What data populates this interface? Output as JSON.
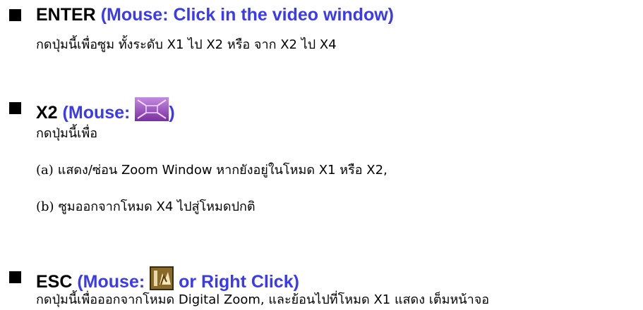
{
  "items": [
    {
      "key": "ENTER",
      "mouse_prefix": "(Mouse: ",
      "mouse_text": "Click in the video window",
      "mouse_suffix": ")",
      "description": "กดปุ่มนี้เพื่อซูม ทั้งระดับ X1 ไป X2 หรือ จาก X2 ไป X4"
    },
    {
      "key": "X2",
      "mouse_prefix": "(Mouse: ",
      "mouse_icon": "zoom-window-icon",
      "mouse_suffix": ")",
      "description": "กดปุ่มนี้เพื่อ",
      "subitems": [
        {
          "tag": "(a)",
          "text": "แสดง/ซ่อน Zoom Window หากยังอยู่ในโหมด X1 หรือ X2,"
        },
        {
          "tag": "(b)",
          "text": "ซูมออกจากโหมด X4 ไปสู่โหมดปกติ"
        }
      ]
    },
    {
      "key": "ESC",
      "mouse_prefix": "(Mouse: ",
      "mouse_icon": "exit-zoom-icon",
      "mouse_text": " or Right Click",
      "mouse_suffix": ")",
      "description": "กดปุ่มนี้เพื่อออกจากโหมด Digital Zoom, และย้อนไปที่โหมด X1 แสดง เต็มหน้าจอ"
    }
  ],
  "colors": {
    "mouse_text": "#3a3af0",
    "bullet": "#000000",
    "zoom_icon": "#8a3fb0",
    "exit_icon": "#6b4a1a"
  }
}
